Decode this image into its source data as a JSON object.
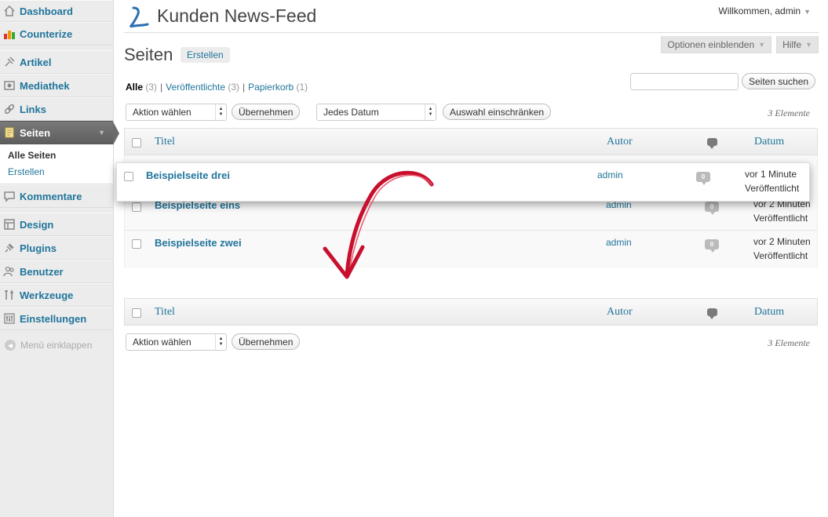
{
  "sidebar": {
    "items": [
      {
        "label": "Dashboard",
        "icon": "home-icon"
      },
      {
        "label": "Counterize",
        "icon": "bar-chart-icon"
      },
      {
        "label": "Artikel",
        "icon": "pin-icon"
      },
      {
        "label": "Mediathek",
        "icon": "media-icon"
      },
      {
        "label": "Links",
        "icon": "link-icon"
      },
      {
        "label": "Seiten",
        "icon": "page-icon"
      },
      {
        "label": "Kommentare",
        "icon": "comment-icon"
      },
      {
        "label": "Design",
        "icon": "design-icon"
      },
      {
        "label": "Plugins",
        "icon": "plugin-icon"
      },
      {
        "label": "Benutzer",
        "icon": "users-icon"
      },
      {
        "label": "Werkzeuge",
        "icon": "tools-icon"
      },
      {
        "label": "Einstellungen",
        "icon": "settings-icon"
      }
    ],
    "submenu": [
      "Alle Seiten",
      "Erstellen"
    ],
    "collapse": "Menü einklappen"
  },
  "header": {
    "site_title": "Kunden News-Feed",
    "welcome": "Willkommen, admin",
    "screen_options": "Optionen einblenden",
    "help": "Hilfe"
  },
  "page": {
    "title": "Seiten",
    "add_new": "Erstellen"
  },
  "views": {
    "all": "Alle",
    "all_count": "(3)",
    "published": "Veröffentlichte",
    "published_count": "(3)",
    "trash": "Papierkorb",
    "trash_count": "(1)"
  },
  "search": {
    "button": "Seiten suchen",
    "value": ""
  },
  "toolbar": {
    "bulk_action": "Aktion wählen",
    "apply": "Übernehmen",
    "date_filter": "Jedes Datum",
    "filter": "Auswahl einschränken",
    "count": "3 Elemente"
  },
  "table": {
    "columns": {
      "title": "Titel",
      "author": "Autor",
      "date": "Datum"
    },
    "rows": [
      {
        "title": "Beispielseite drei",
        "author": "admin",
        "comments": "0",
        "date": "vor 1 Minute",
        "status": "Veröffentlicht"
      },
      {
        "title": "Beispielseite eins",
        "author": "admin",
        "comments": "0",
        "date": "vor 2 Minuten",
        "status": "Veröffentlicht"
      },
      {
        "title": "Beispielseite zwei",
        "author": "admin",
        "comments": "0",
        "date": "vor 2 Minuten",
        "status": "Veröffentlicht"
      }
    ]
  },
  "colors": {
    "link": "#21759b",
    "active_menu": "#6c6c6c",
    "arrow": "#c8102e"
  }
}
